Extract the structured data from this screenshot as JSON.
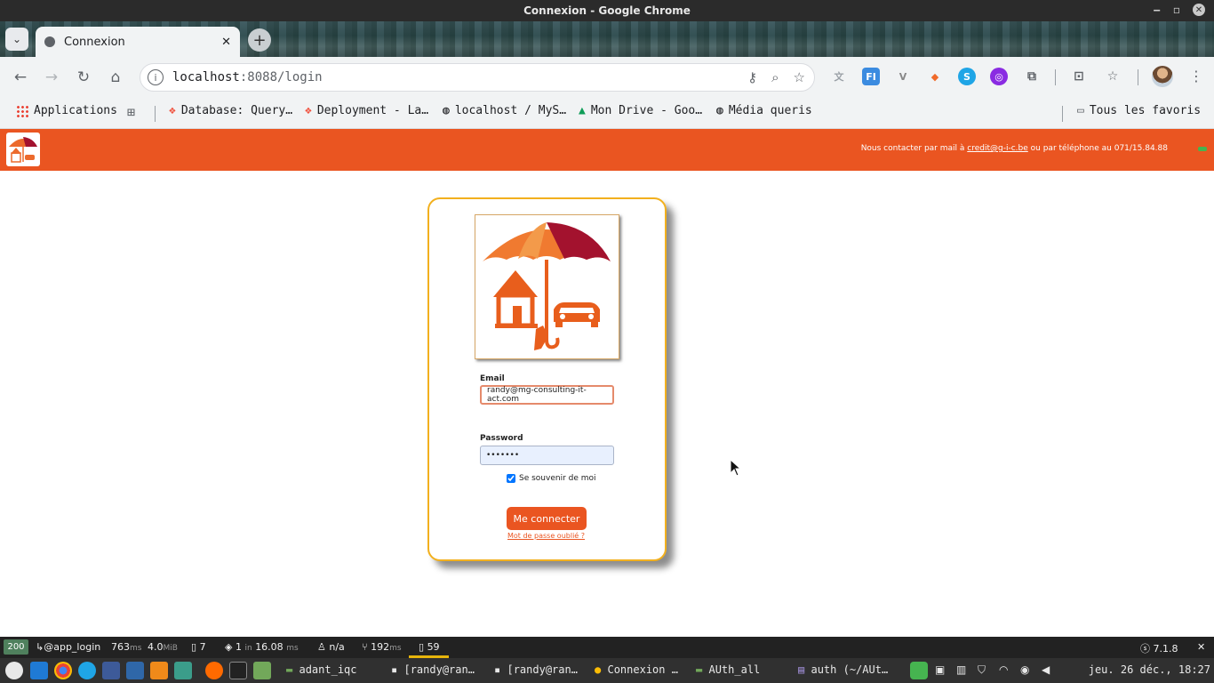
{
  "window": {
    "title": "Connexion - Google Chrome"
  },
  "tabs": [
    {
      "label": "Connexion",
      "close": "✕"
    }
  ],
  "toolbar": {
    "url_host": "localhost",
    "url_path": ":8088/login"
  },
  "bookmarks": {
    "items": [
      {
        "label": "Applications"
      },
      {
        "label": "Database: Query…"
      },
      {
        "label": "Deployment - La…"
      },
      {
        "label": "localhost / MyS…"
      },
      {
        "label": "Mon Drive - Goo…"
      },
      {
        "label": "Média queris"
      }
    ],
    "all_bookmarks": "Tous les favoris"
  },
  "site": {
    "contact_prefix": "Nous contacter par mail à ",
    "contact_email": "credit@g-i-c.be",
    "contact_suffix": " ou par téléphone au 071/15.84.88"
  },
  "login": {
    "email_label": "Email",
    "email_value": "randy@mg-consulting-it-act.com",
    "password_label": "Password",
    "password_value": "•••••••",
    "remember_label": "Se souvenir de moi",
    "remember_checked": true,
    "submit_label": "Me connecter",
    "forgot_label": "Mot de passe oublié ?"
  },
  "debug": {
    "status": "200",
    "route": "@app_login",
    "time_value": "763",
    "time_unit": "ms",
    "memory_value": "4.0",
    "memory_unit": "MiB",
    "forms": "7",
    "db_queries": "1",
    "db_in": "in",
    "db_time": "16.08",
    "db_unit": "ms",
    "user": "n/a",
    "cache_value": "192",
    "cache_unit": "ms",
    "twig": "59",
    "version": "7.1.8"
  },
  "taskbar": {
    "items": [
      {
        "label": "adant_iqc"
      },
      {
        "label": "[randy@ran…"
      },
      {
        "label": "[randy@ran…"
      },
      {
        "label": "Connexion …"
      },
      {
        "label": "AUth_all"
      },
      {
        "label": "auth (~/AUt…"
      }
    ],
    "clock": "jeu. 26 déc., 18:27"
  },
  "colors": {
    "brand_orange": "#ea5521",
    "card_border": "#f2b01e"
  }
}
